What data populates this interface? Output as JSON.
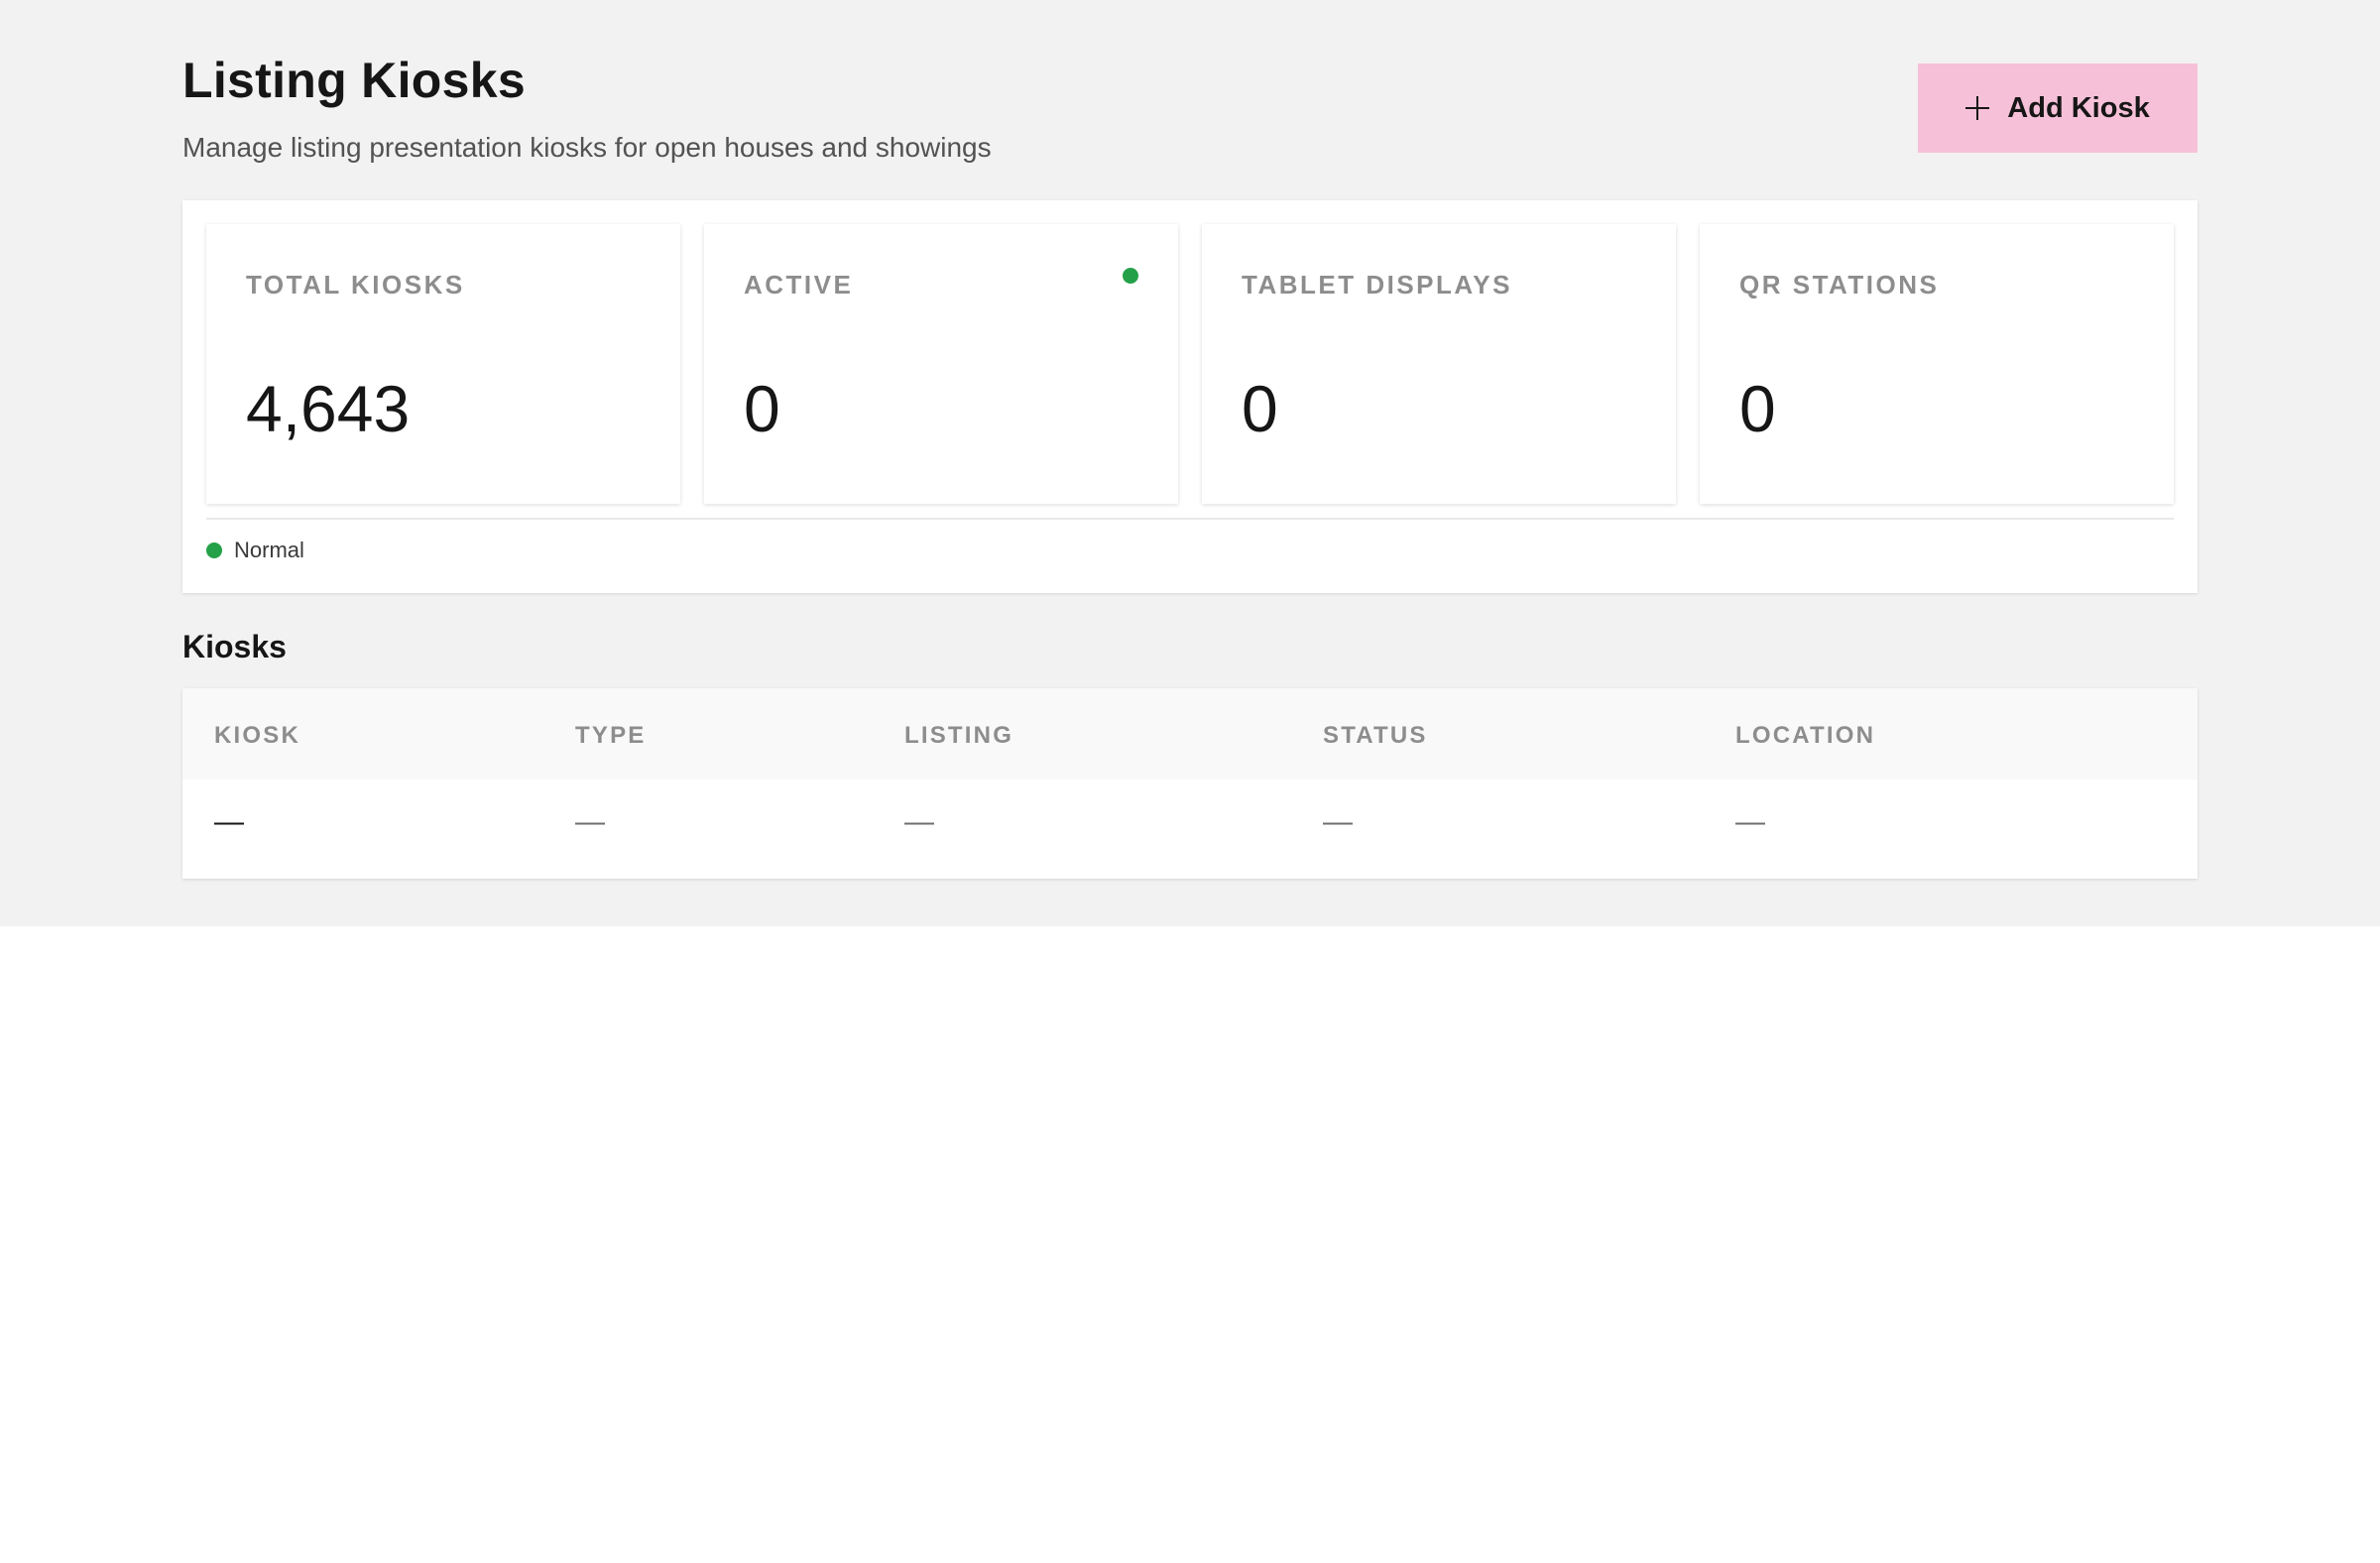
{
  "header": {
    "title": "Listing Kiosks",
    "subtitle": "Manage listing presentation kiosks for open houses and showings",
    "add_button_label": "Add Kiosk",
    "add_button_icon": "plus-icon"
  },
  "stats": [
    {
      "label": "TOTAL KIOSKS",
      "value": "4,643"
    },
    {
      "label": "ACTIVE",
      "value": "0",
      "indicator_color": "#24a148"
    },
    {
      "label": "TABLET DISPLAYS",
      "value": "0"
    },
    {
      "label": "QR STATIONS",
      "value": "0"
    }
  ],
  "legend": {
    "label": "Normal",
    "color": "#24a148"
  },
  "kiosks_section": {
    "title": "Kiosks",
    "columns": [
      "KIOSK",
      "TYPE",
      "LISTING",
      "STATUS",
      "LOCATION"
    ],
    "rows": [
      [
        "—",
        "—",
        "—",
        "—",
        "—"
      ]
    ]
  },
  "colors": {
    "accent_button": "#f6c1d8",
    "status_green": "#24a148",
    "page_background": "#f2f2f2"
  }
}
